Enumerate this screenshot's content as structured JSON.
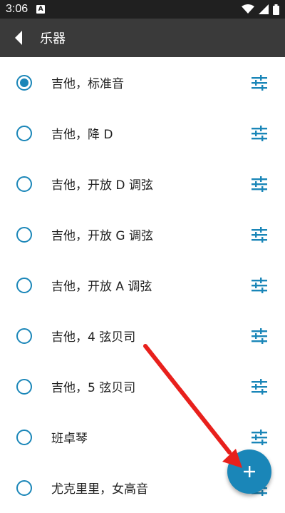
{
  "status_bar": {
    "time": "3:06",
    "notification_badge": "A"
  },
  "app_bar": {
    "title": "乐器"
  },
  "instruments": [
    {
      "label": "吉他，标准音",
      "selected": true
    },
    {
      "label": "吉他，降 D",
      "selected": false
    },
    {
      "label": "吉他，开放 D 调弦",
      "selected": false
    },
    {
      "label": "吉他，开放 G 调弦",
      "selected": false
    },
    {
      "label": "吉他，开放 A 调弦",
      "selected": false
    },
    {
      "label": "吉他，4 弦贝司",
      "selected": false
    },
    {
      "label": "吉他，5 弦贝司",
      "selected": false
    },
    {
      "label": "班卓琴",
      "selected": false
    },
    {
      "label": "尤克里里，女高音",
      "selected": false
    }
  ],
  "icons": {
    "back": "back-arrow-icon",
    "row_action": "tune-sliders-icon",
    "fab": "plus-icon"
  },
  "colors": {
    "accent": "#1a86b8",
    "app_bar": "#3a3a3a",
    "status_bar": "#202020",
    "annotation_arrow": "#e8201c"
  }
}
